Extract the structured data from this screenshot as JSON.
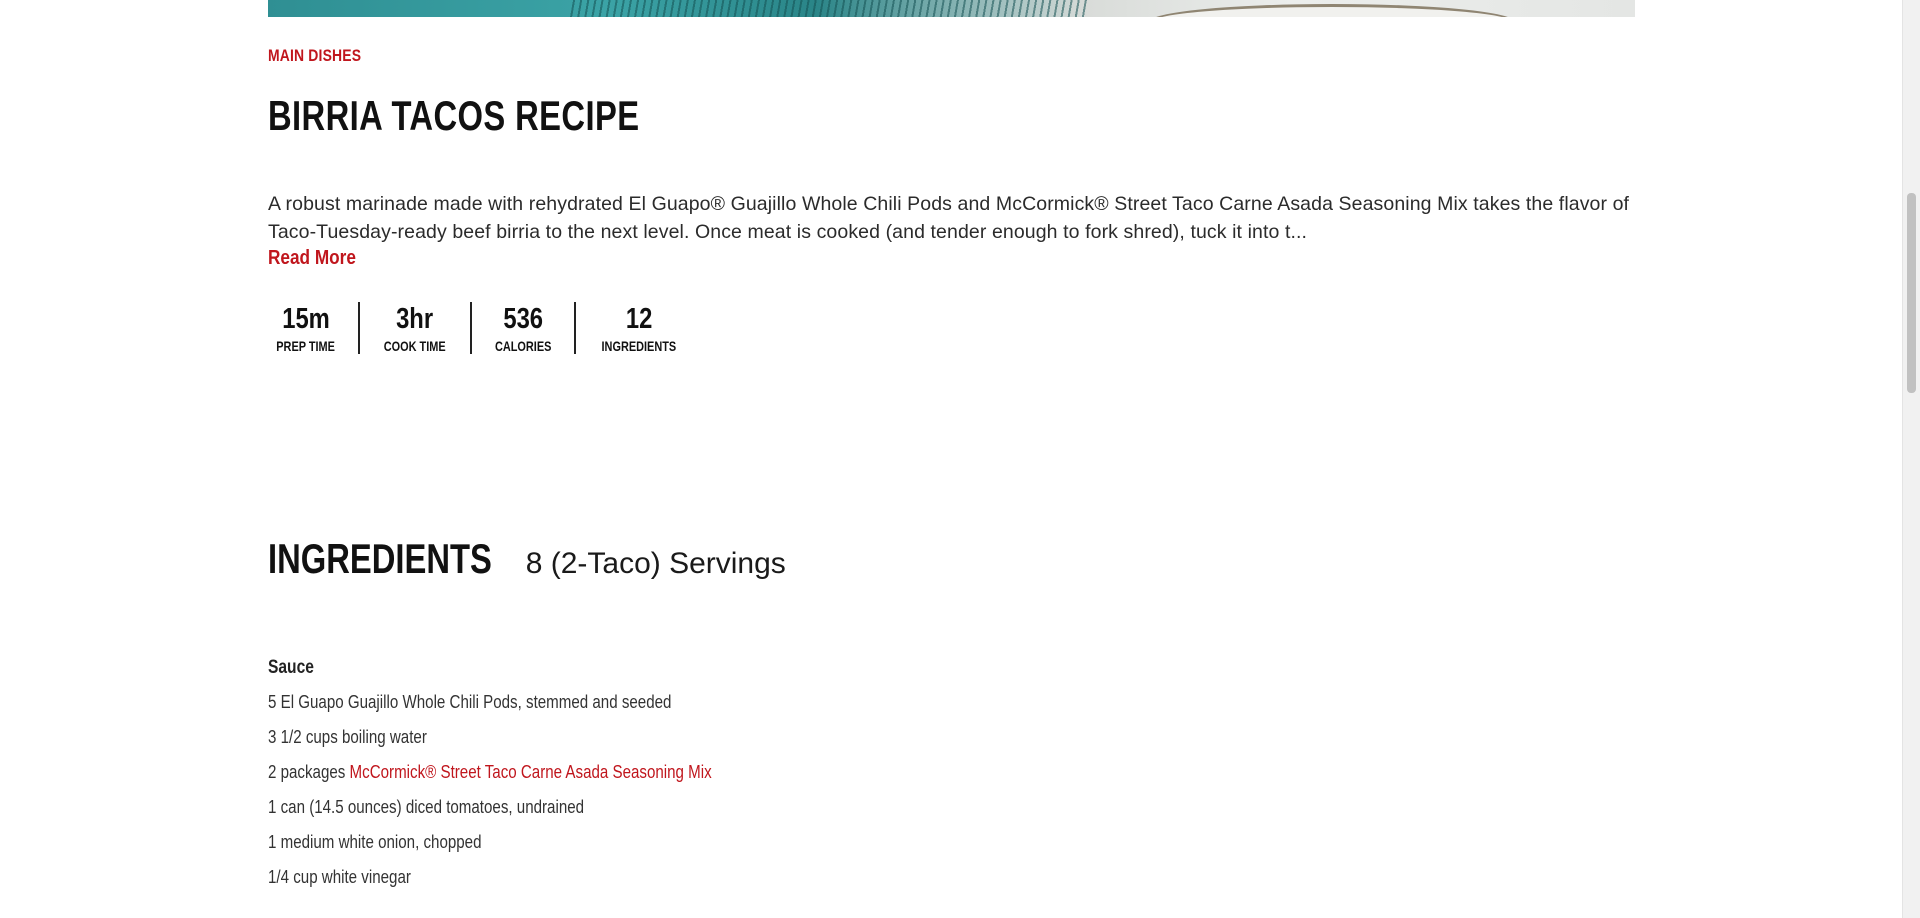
{
  "recipe": {
    "category": "MAIN DISHES",
    "title": "BIRRIA TACOS RECIPE",
    "description": "A robust marinade made with rehydrated El Guapo® Guajillo Whole Chili Pods and McCormick® Street Taco Carne Asada Seasoning Mix takes the flavor of Taco-Tuesday-ready beef birria to the next level. Once meat is cooked (and tender enough to fork shred), tuck it into t...",
    "read_more_label": "Read More",
    "stats": [
      {
        "value": "15m",
        "label": "PREP TIME"
      },
      {
        "value": "3hr",
        "label": "COOK TIME"
      },
      {
        "value": "536",
        "label": "CALORIES"
      },
      {
        "value": "12",
        "label": "INGREDIENTS"
      }
    ]
  },
  "ingredients": {
    "title": "INGREDIENTS",
    "servings": "8 (2-Taco) Servings",
    "section_title": "Sauce",
    "items": [
      {
        "text": "5 El Guapo Guajillo Whole Chili Pods, stemmed and seeded"
      },
      {
        "text": "3 1/2 cups boiling water"
      },
      {
        "prefix": "2 packages ",
        "link": "McCormick® Street Taco Carne Asada Seasoning Mix"
      },
      {
        "text": "1 can (14.5 ounces) diced tomatoes, undrained"
      },
      {
        "text": "1 medium white onion, chopped"
      },
      {
        "text": "1/4 cup white vinegar"
      }
    ]
  },
  "colors": {
    "accent_red": "#c0161d",
    "text_dark": "#111111"
  }
}
